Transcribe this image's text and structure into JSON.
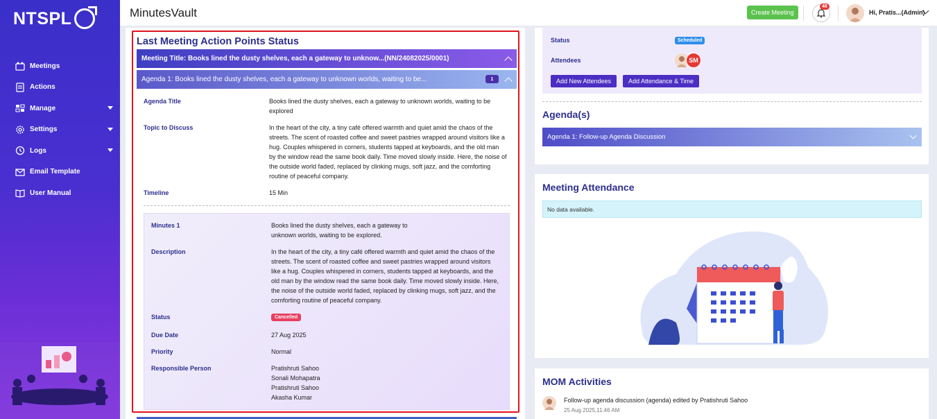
{
  "sidebar": {
    "logo": "NTSPL",
    "items": [
      {
        "label": "Meetings",
        "icon": "meetings-icon",
        "has_caret": false
      },
      {
        "label": "Actions",
        "icon": "actions-icon",
        "has_caret": false
      },
      {
        "label": "Manage",
        "icon": "manage-icon",
        "has_caret": true
      },
      {
        "label": "Settings",
        "icon": "settings-icon",
        "has_caret": true
      },
      {
        "label": "Logs",
        "icon": "logs-icon",
        "has_caret": true
      },
      {
        "label": "Email Template",
        "icon": "email-icon",
        "has_caret": false
      },
      {
        "label": "User Manual",
        "icon": "manual-icon",
        "has_caret": false
      }
    ]
  },
  "header": {
    "title": "MinutesVault",
    "create_button": "Create Meeting",
    "notification_count": "48",
    "user_greeting": "Hi, Pratis...(Admin)"
  },
  "left": {
    "title": "Last Meeting Action Points Status",
    "meeting_bar": "Meeting Title: Books lined the dusty shelves, each a gateway to unknow...(NN/24082025/0001)",
    "agenda_bar": "Agenda 1: Books lined the dusty shelves, each a gateway to unknown worlds, waiting to be...",
    "agenda_count": "1",
    "agenda_title_label": "Agenda Title",
    "agenda_title_value": "Books lined the dusty shelves, each a gateway to unknown worlds, waiting to be explored",
    "topic_label": "Topic to Discuss",
    "topic_value": "In the heart of the city, a tiny café offered warmth and quiet amid the chaos of the streets. The scent of roasted coffee and sweet pastries wrapped around visitors like a hug. Couples whispered in corners, students tapped at keyboards, and the old man by the window read the same book daily. Time moved slowly inside. Here, the noise of the outside world faded, replaced by clinking mugs, soft jazz, and the comforting routine of peaceful company.",
    "timeline_label": "Timeline",
    "timeline_value": "15 Min",
    "minutes": {
      "minutes_label": "Minutes 1",
      "minutes_value": "Books lined the dusty shelves, each a gateway to unknown worlds, waiting to be explored.",
      "description_label": "Description",
      "description_value": "In the heart of the city, a tiny café offered warmth and quiet amid the chaos of the streets. The scent of roasted coffee and sweet pastries wrapped around visitors like a hug. Couples whispered in corners, students tapped at keyboards, and the old man by the window read the same book daily. Time moved slowly inside. Here, the noise of the outside world faded, replaced by clinking mugs, soft jazz, and the comforting routine of peaceful company.",
      "status_label": "Status",
      "status_value": "Cancelled",
      "due_label": "Due Date",
      "due_value": "27 Aug 2025",
      "priority_label": "Priority",
      "priority_value": "Normal",
      "responsible_label": "Responsible Person",
      "responsible": [
        "Pratishruti Sahoo",
        "Sonali Mohapatra",
        "Pratishruti Sahoo",
        "Akasha Kumar"
      ]
    }
  },
  "right": {
    "status_label": "Status",
    "status_value": "Scheduled",
    "attendees_label": "Attendees",
    "attendee_initials": "SM",
    "add_attendees_button": "Add New Attendees",
    "add_attendance_button": "Add Attendance & Time",
    "agenda_section_title": "Agenda(s)",
    "agenda_item": "Agenda 1: Follow-up Agenda Discussion",
    "attendance_title": "Meeting Attendance",
    "no_data": "No data available.",
    "mom_title": "MOM Activities",
    "mom_activity": "Follow-up agenda discussion (agenda) edited by Pratishruti Sahoo",
    "mom_time": "25 Aug 2025,11:46 AM"
  },
  "colors": {
    "accent": "#2d2f8c",
    "highlight": "#e0141e",
    "create": "#5cc24e",
    "purple_button": "#4b2fc2"
  }
}
